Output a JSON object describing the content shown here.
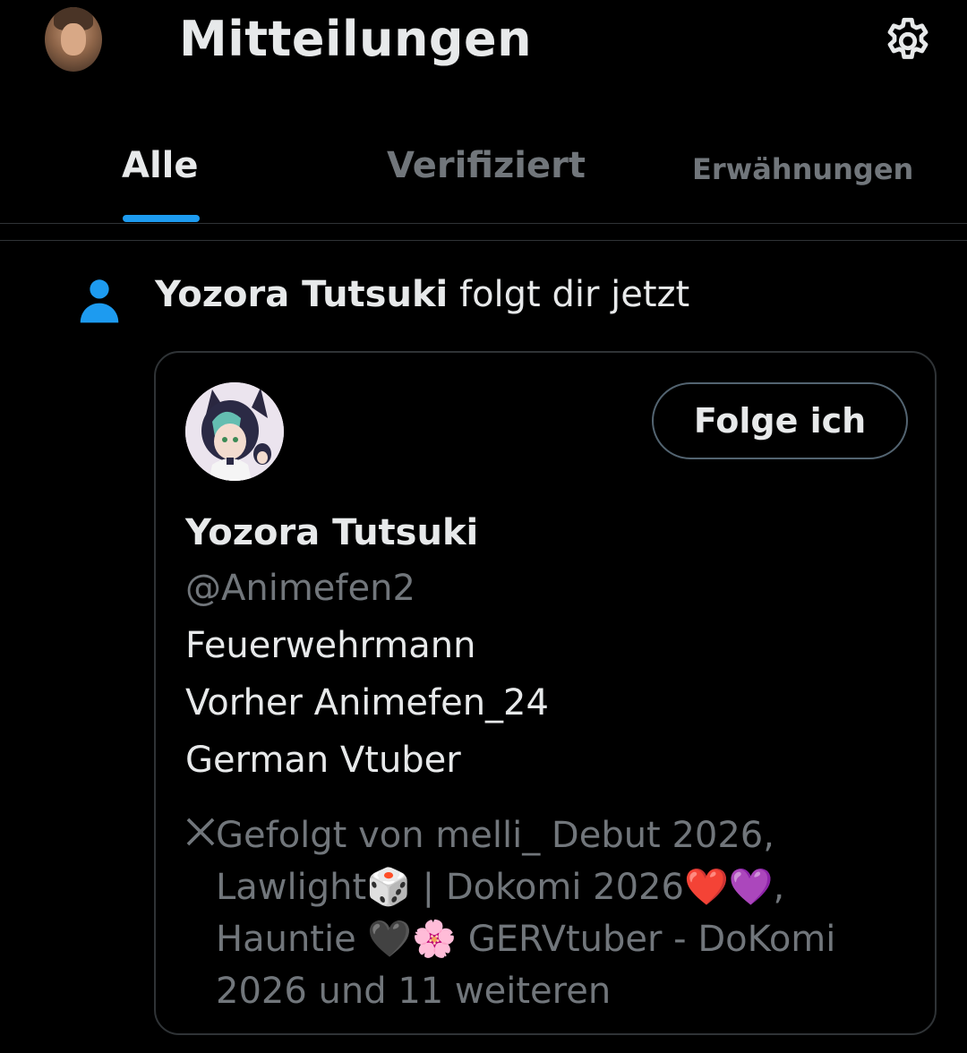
{
  "header": {
    "title": "Mitteilungen",
    "settings_icon": "gear-icon",
    "avatar_icon": "user-avatar"
  },
  "tabs": [
    {
      "label": "Alle",
      "active": true
    },
    {
      "label": "Verifiziert",
      "active": false
    },
    {
      "label": "Erwähnungen",
      "active": false
    }
  ],
  "colors": {
    "accent": "#1d9bf0",
    "background": "#000000",
    "text_primary": "#e7e9ea",
    "text_secondary": "#71767b",
    "border": "#2f3336"
  },
  "notification": {
    "icon": "person-icon",
    "actor_name": "Yozora Tutsuki",
    "action_text": "folgt dir jetzt"
  },
  "card": {
    "display_name": "Yozora Tutsuki",
    "handle": "@Animefen2",
    "bio": [
      "Feuerwehrmann",
      "Vorher Animefen_24",
      "German Vtuber"
    ],
    "follow_button_label": "Folge ich",
    "followed_by_text": "Gefolgt von melli_ Debut 2026, Lawlight🎲 | Dokomi 2026❤️💜, Hauntie 🖤🌸 GERVtuber - DoKomi 2026 und 11 weiteren"
  }
}
